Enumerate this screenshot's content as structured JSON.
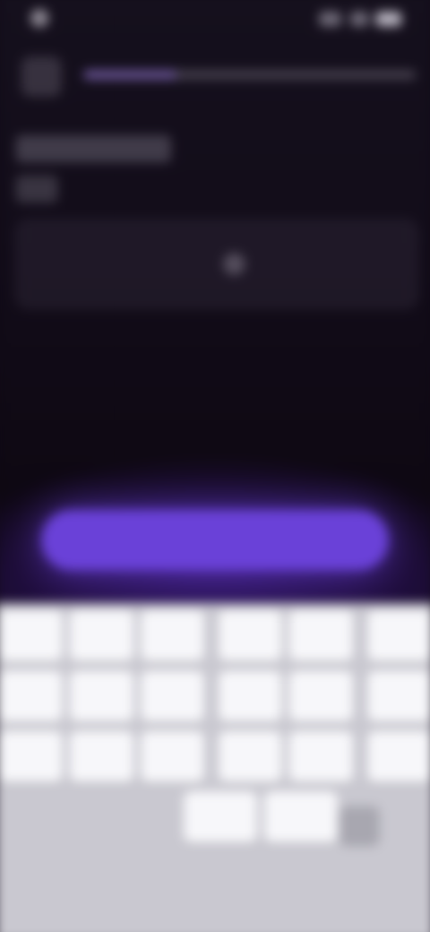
{
  "status_bar": {
    "time": "",
    "icons": [
      "signal-icon",
      "wifi-icon",
      "battery-icon"
    ]
  },
  "header": {
    "back_icon": "back-arrow-icon",
    "progress_fraction": 0.28
  },
  "title": {
    "line1": "",
    "line2": ""
  },
  "input": {
    "value": "",
    "placeholder": ""
  },
  "primary_button": {
    "label": ""
  },
  "keyboard": {
    "rows": [
      [
        "",
        "",
        "",
        "",
        "",
        ""
      ],
      [
        "",
        "",
        "",
        "",
        "",
        ""
      ],
      [
        "",
        "",
        "",
        "",
        "",
        ""
      ]
    ],
    "bottom_row": [
      "",
      ""
    ],
    "delete_icon": "backspace-icon"
  },
  "colors": {
    "background": "#0f0914",
    "accent": "#6a41d8",
    "keyboard_background": "#c9c8d0",
    "key_background": "#f7f7fa"
  }
}
